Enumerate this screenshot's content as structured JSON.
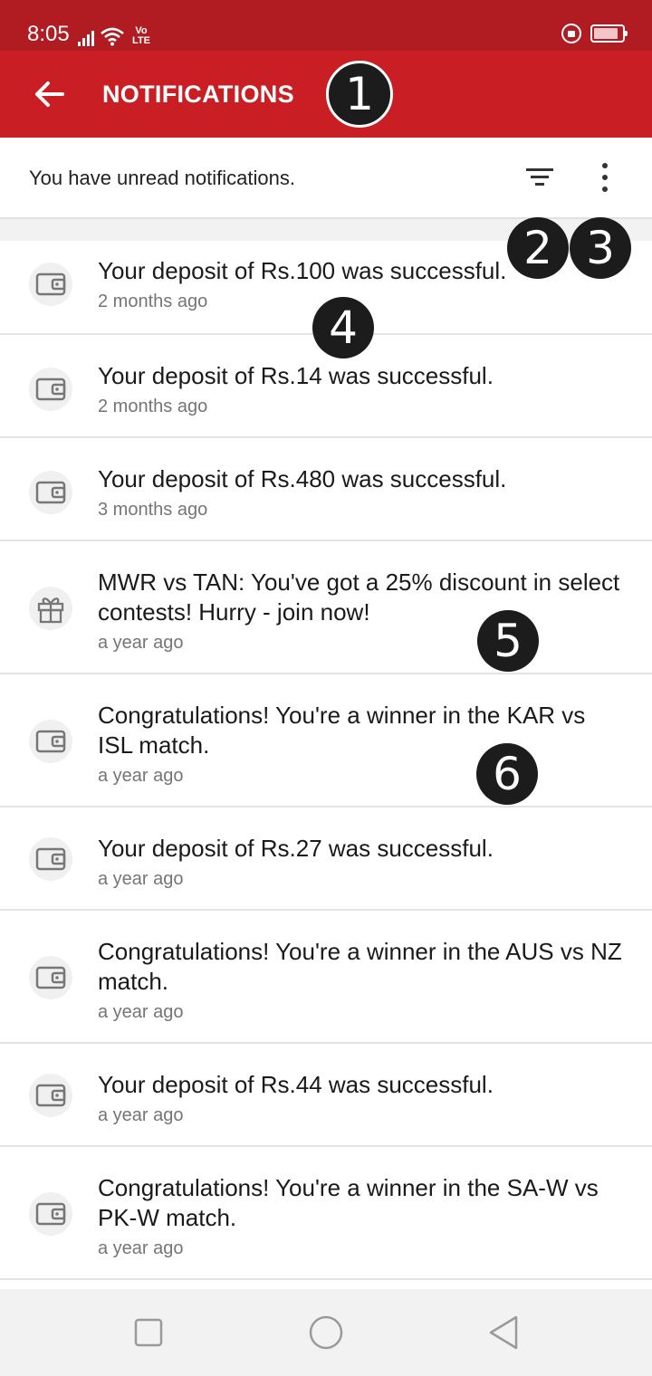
{
  "status_bar": {
    "time": "8:05",
    "volte_top": "Vo",
    "volte_bottom": "LTE"
  },
  "app_bar": {
    "title": "NOTIFICATIONS",
    "color": "#c81e24"
  },
  "subheader": {
    "text": "You have unread notifications."
  },
  "markers": [
    "1",
    "2",
    "3",
    "4",
    "5",
    "6"
  ],
  "notifications": [
    {
      "title": "Your deposit of Rs.100 was successful.",
      "time": "2 months ago",
      "icon": "wallet-icon"
    },
    {
      "title": "Your deposit of Rs.14 was successful.",
      "time": "2 months ago",
      "icon": "wallet-icon"
    },
    {
      "title": "Your deposit of Rs.480 was successful.",
      "time": "3 months ago",
      "icon": "wallet-icon"
    },
    {
      "title": "MWR vs TAN: You've got a 25% discount in select contests! Hurry - join now!",
      "time": "a year ago",
      "icon": "gift-icon"
    },
    {
      "title": "Congratulations! You're a winner in the KAR vs ISL match.",
      "time": "a year ago",
      "icon": "wallet-icon"
    },
    {
      "title": "Your deposit of Rs.27 was successful.",
      "time": "a year ago",
      "icon": "wallet-icon"
    },
    {
      "title": "Congratulations! You're a winner in the AUS vs NZ match.",
      "time": "a year ago",
      "icon": "wallet-icon"
    },
    {
      "title": "Your deposit of Rs.44 was successful.",
      "time": "a year ago",
      "icon": "wallet-icon"
    },
    {
      "title": "Congratulations! You're a winner in the SA-W vs PK-W match.",
      "time": "a year ago",
      "icon": "wallet-icon"
    }
  ]
}
